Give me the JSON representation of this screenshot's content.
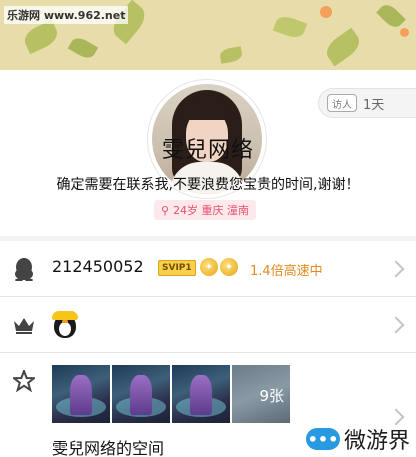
{
  "watermark": {
    "site_text": "乐游网 www.962.net",
    "bottom_text": "微游界",
    "bottom_logo_glyph": "•••"
  },
  "profile": {
    "nickname": "雯兒网络",
    "signature": "确定需要在联系我,不要浪费您宝贵的时间,谢谢！",
    "tag": "24岁 重庆 潼南",
    "tag_icon": "search-icon",
    "visitor_icon_label": "访人",
    "visitor_count": "1天"
  },
  "rows": {
    "qq": {
      "icon": "penguin-icon",
      "number": "212450052",
      "svip_label": "SVIP1",
      "crown_glyph": "✦",
      "speed_text": "1.4倍高速中"
    },
    "vip": {
      "icon": "crown-icon"
    },
    "space": {
      "icon": "star-icon",
      "photo_count": "9张",
      "title": "雯兒网络的空间"
    }
  },
  "colors": {
    "accent_pink": "#e8506f",
    "speed_orange": "#e08a1f",
    "svip_gold": "#f5d04a"
  }
}
